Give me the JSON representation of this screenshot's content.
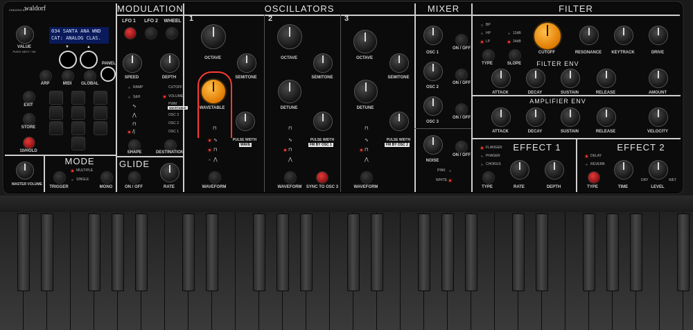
{
  "brand": {
    "creator": "CREATED BY",
    "name": "waldorf"
  },
  "display": {
    "line1": "034 SANTA ANA WND",
    "line2": "CAT: ANALOG CLAS."
  },
  "global": {
    "value_label": "VALUE",
    "value_hint": "PUSH: NEXT / OK",
    "panel_label": "PANEL",
    "arp": "ARP",
    "midi": "MIDI",
    "global": "GLOBAL",
    "exit": "EXIT",
    "store": "STORE",
    "hold": "10/HOLD",
    "master_volume": "MASTER VOLUME"
  },
  "mode": {
    "title": "MODE",
    "multiple": "MULTIPLE",
    "single": "SINGLE",
    "trigger": "TRIGGER",
    "mono": "MONO"
  },
  "modulation": {
    "title": "MODULATION",
    "tabs": [
      "LFO 1",
      "LFO 2",
      "WHEEL"
    ],
    "speed": "SPEED",
    "depth": "DEPTH",
    "shapes": [
      "RAMP",
      "S&H"
    ],
    "shape": "SHAPE",
    "destinations": [
      "CUTOFF",
      "VOLUME",
      "PWM",
      "WAVETABLE",
      "OSC 3",
      "OSC 2",
      "OSC 1"
    ],
    "destination": "DESTINATION"
  },
  "glide": {
    "title": "GLIDE",
    "onoff": "ON / OFF",
    "rate": "RATE"
  },
  "oscillators": {
    "title": "OSCILLATORS",
    "octave": "OCTAVE",
    "semitone": "SEMITONE",
    "wavetable": "WAVETABLE",
    "detune": "DETUNE",
    "pulse_width": "PULSE WIDTH",
    "wave_box": "WAVE",
    "fm_osc1": "FM BY OSC 1",
    "fm_osc2": "FM BY OSC 2",
    "waveform": "WAVEFORM",
    "sync": "SYNC TO OSC 3",
    "numbers": [
      "1",
      "2",
      "3"
    ]
  },
  "mixer": {
    "title": "MIXER",
    "osc1": "OSC 1",
    "osc2": "OSC 2",
    "osc3": "OSC 3",
    "noise": "NOISE",
    "onoff": "ON / OFF",
    "pink": "PINK",
    "white": "WHITE"
  },
  "filter": {
    "title": "FILTER",
    "types": [
      "BP",
      "HP",
      "LP"
    ],
    "slopes": [
      "12dB",
      "24dB"
    ],
    "type": "TYPE",
    "slope": "SLOPE",
    "cutoff": "CUTOFF",
    "resonance": "RESONANCE",
    "keytrack": "KEYTRACK",
    "drive": "DRIVE",
    "filter_env": "FILTER ENV",
    "amp_env": "AMPLIFIER ENV",
    "attack": "ATTACK",
    "decay": "DECAY",
    "sustain": "SUSTAIN",
    "release": "RELEASE",
    "amount": "AMOUNT",
    "velocity": "VELOCITY"
  },
  "effect1": {
    "title": "EFFECT 1",
    "types": [
      "FLANGER",
      "PHASER",
      "CHORUS"
    ],
    "type": "TYPE",
    "rate": "RATE",
    "depth": "DEPTH"
  },
  "effect2": {
    "title": "EFFECT 2",
    "types": [
      "DELAY",
      "REVERB"
    ],
    "type": "TYPE",
    "time": "TIME",
    "level": "LEVEL",
    "dry": "DRY",
    "wet": "WET"
  },
  "colors": {
    "accent_orange": "#f59a12",
    "led_red": "#ff3b2f",
    "lcd_blue": "#0a1a5a"
  }
}
